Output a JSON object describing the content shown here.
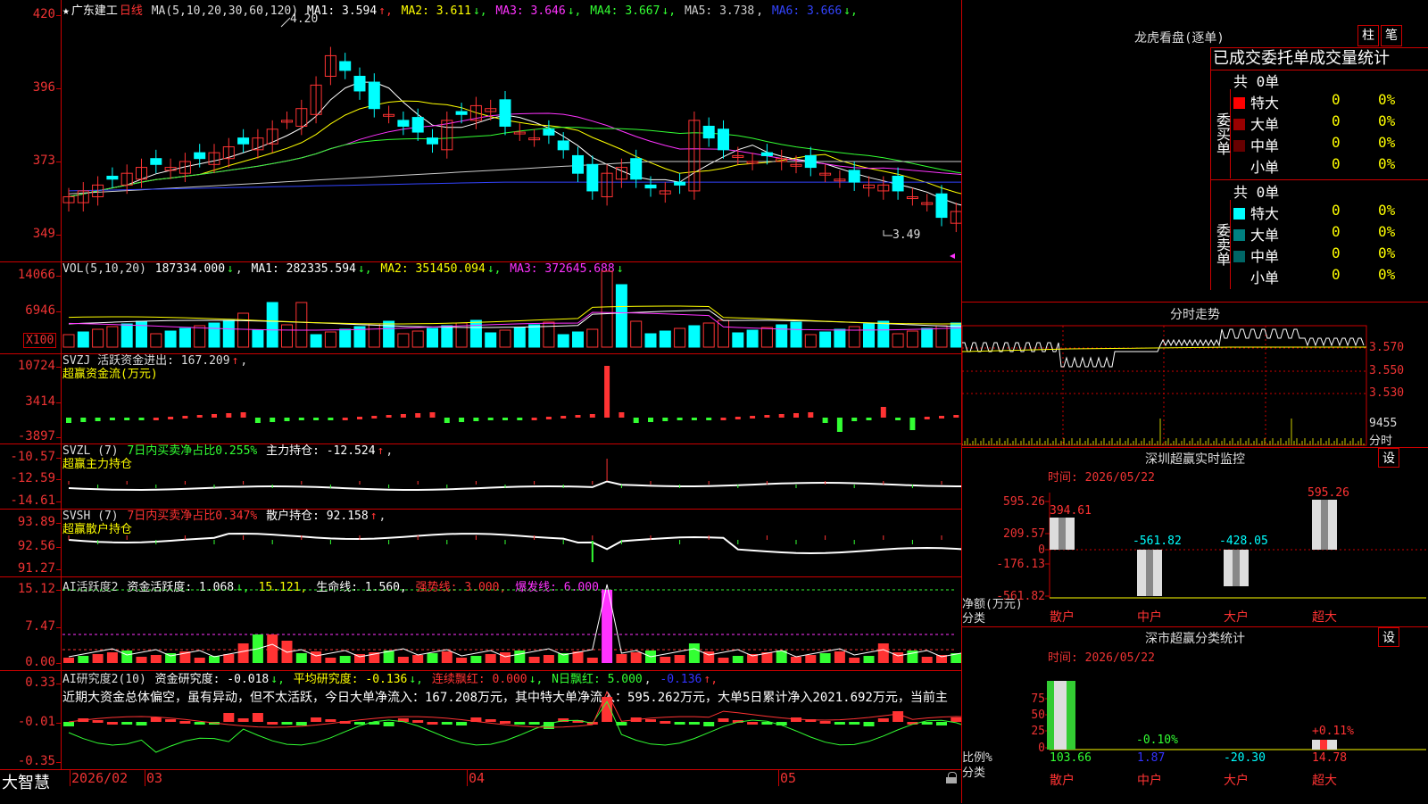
{
  "stock": {
    "star": "★",
    "name": "广东建工",
    "period": "日线"
  },
  "kline": {
    "ma_prefix": "MA(5,10,20,30,60,120)",
    "mas": [
      {
        "label": "MA1: 3.594",
        "arrow": "↑",
        "color": "#ffffff"
      },
      {
        "label": "MA2: 3.611",
        "arrow": "↓",
        "color": "#ffff00"
      },
      {
        "label": "MA3: 3.646",
        "arrow": "↓",
        "color": "#ff33ff"
      },
      {
        "label": "MA4: 3.667",
        "arrow": "↓",
        "color": "#33ff33"
      },
      {
        "label": "MA5: 3.738",
        "arrow": ",",
        "color": "#cccccc"
      },
      {
        "label": "MA6: 3.666",
        "arrow": "↓",
        "color": "#3344ff"
      }
    ],
    "yticks": [
      "420",
      "396",
      "373",
      "349"
    ],
    "high_label": "4.20",
    "low_label": "3.49"
  },
  "vol": {
    "prefix": "VOL(5,10,20)",
    "value": "187334.000",
    "arrow": "↓",
    "ma1": "MA1: 282335.594",
    "ma2": "MA2: 351450.094",
    "ma3": "MA3: 372645.688",
    "yticks": [
      "14066",
      "6946"
    ],
    "unit": "X100"
  },
  "svzj": {
    "line1": "SVZJ  活跃资金进出: 167.209",
    "arrow": "↑",
    "line2": "超赢资金流(万元)",
    "yticks": [
      "10724",
      "3414",
      "-3897"
    ]
  },
  "svzl": {
    "p1": "SVZL (7)",
    "p2": "7日内买卖净占比0.255%",
    "p3": "主力持仓: -12.524",
    "arrow": "↑",
    "line2": "超赢主力持仓",
    "yticks": [
      "-10.57",
      "-12.59",
      "-14.61"
    ]
  },
  "svsh": {
    "p1": "SVSH (7)",
    "p2": "7日内买卖净占比0.347%",
    "p3": "散户持仓: 92.158",
    "arrow": "↑",
    "line2": "超赢散户持仓",
    "yticks": [
      "93.89",
      "92.56",
      "91.27"
    ]
  },
  "ai2": {
    "p1": "AI活跃度2",
    "p2": "资金活跃度: 1.068",
    "p3": "15.121,",
    "p4": "生命线: 1.560,",
    "p5": "强势线: 3.000,",
    "p6": "爆发线: 6.000,",
    "yticks": [
      "15.12",
      "7.47",
      "0.00"
    ]
  },
  "ai3": {
    "p1": "AI研究度2(10)",
    "p2": "资金研究度: -0.018",
    "p3": "平均研究度: -0.136",
    "p4": "连续飘红: 0.000",
    "p5": "N日飘红: 5.000",
    "p6": "-0.136",
    "comment": "近期大资金总体偏空，虽有异动，但不太活跃，今日大单净流入：167.208万元，其中特大单净流入：595.262万元，大单5日累计净入2021.692万元，当前主",
    "yticks": [
      "0.33",
      "-0.01",
      "-0.35"
    ]
  },
  "bottom": {
    "brand": "大智慧",
    "dates": [
      "2026/02",
      "03",
      "04",
      "05"
    ]
  },
  "lhb": {
    "title": "龙虎看盘(逐单)",
    "btn1": "柱",
    "btn2": "笔",
    "header": "已成交委托单成交量统计",
    "buy": {
      "side": "委买单",
      "total": "共 0单",
      "rows": [
        {
          "name": "特大",
          "v": "0",
          "p": "0%",
          "color": "#ff0000"
        },
        {
          "name": "大单",
          "v": "0",
          "p": "0%",
          "color": "#990000"
        },
        {
          "name": "中单",
          "v": "0",
          "p": "0%",
          "color": "#660000"
        },
        {
          "name": "小单",
          "v": "0",
          "p": "0%",
          "color": "#000000"
        }
      ]
    },
    "sell": {
      "side": "委卖单",
      "total": "共 0单",
      "rows": [
        {
          "name": "特大",
          "v": "0",
          "p": "0%",
          "color": "#00ffff"
        },
        {
          "name": "大单",
          "v": "0",
          "p": "0%",
          "color": "#008080"
        },
        {
          "name": "中单",
          "v": "0",
          "p": "0%",
          "color": "#006666"
        },
        {
          "name": "小单",
          "v": "0",
          "p": "0%",
          "color": "#000000"
        }
      ]
    }
  },
  "fenshi": {
    "title": "分时走势",
    "yticks": [
      "3.570",
      "3.550",
      "3.530"
    ],
    "vol": "9455",
    "vol_label": "分时"
  },
  "sz_monitor": {
    "title": "深圳超赢实时监控",
    "btn": "设",
    "time": "时间: 2026/05/22",
    "yticks": [
      "595.26",
      "209.57",
      "0",
      "-176.13",
      "-561.82"
    ],
    "unit1": "净额(万元)",
    "unit2": "分类",
    "cats": [
      "散户",
      "中户",
      "大户",
      "超大"
    ],
    "values": [
      "394.61",
      "-561.82",
      "-428.05",
      "595.26"
    ]
  },
  "sz_stat": {
    "title": "深市超赢分类统计",
    "btn": "设",
    "time": "时间: 2026/05/22",
    "yticks": [
      "75",
      "50",
      "25",
      "0"
    ],
    "unit1": "比例%",
    "unit2": "分类",
    "cats": [
      "散户",
      "中户",
      "大户",
      "超大"
    ],
    "values": [
      "103.66",
      "1.87",
      "-20.30",
      "14.78"
    ],
    "bar_labels": [
      "-0.10%",
      "+0.11%"
    ]
  }
}
